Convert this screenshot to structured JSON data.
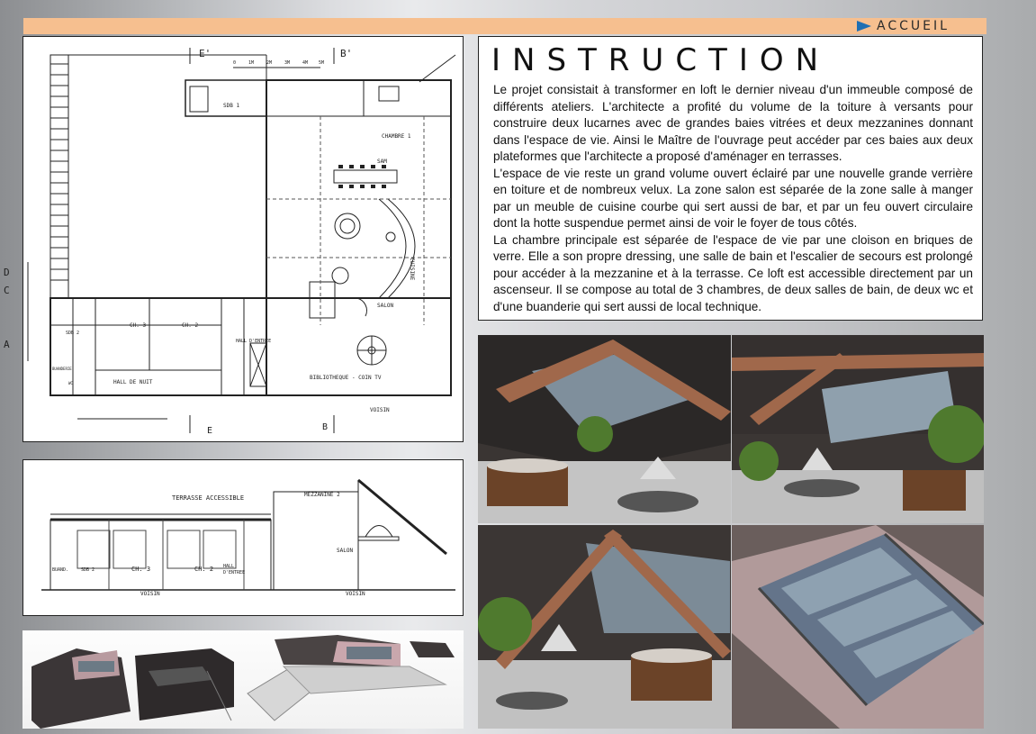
{
  "header": {
    "nav_label": "ACCUEIL",
    "accent_color": "#f6bf8f",
    "arrow_color": "#1f6fb3"
  },
  "plan": {
    "markers": {
      "e_top": "E'",
      "b_top": "B'",
      "e_bottom": "E",
      "b_bottom": "B",
      "d": "D",
      "c": "C",
      "a": "A"
    },
    "scale_labels": [
      "0",
      "1M",
      "2M",
      "3M",
      "4M",
      "5M"
    ],
    "rooms": {
      "sdb1": "SDB 1",
      "chambre1": "CHAMBRE 1",
      "sam": "SAM",
      "cuisine": "CUISINE",
      "salon": "SALON",
      "ch3": "CH. 3",
      "ch2": "CH. 2",
      "sdb2": "SDB 2",
      "buanderie": "BUANDERIE",
      "wc": "WC",
      "hall_nuit": "HALL DE NUIT",
      "hall_entree": "HALL D'ENTREE",
      "bibliotheque": "BIBLIOTHEQUE - COIN TV",
      "voisin": "VOISIN"
    }
  },
  "section": {
    "labels": {
      "terrasse": "TERRASSE ACCESSIBLE",
      "mezzanine": "MEZZANINE 2",
      "salon": "SALON",
      "buand": "BUAND.",
      "sdb2": "SDB 2",
      "ch3": "CH. 3",
      "ch2": "CH. 2",
      "hall": "HALL",
      "hall2": "D'ENTREE",
      "voisin_left": "VOISIN",
      "voisin_right": "VOISIN"
    }
  },
  "instruction": {
    "title": "INSTRUCTION",
    "paragraphs": [
      "Le projet consistait à transformer en loft le dernier niveau d'un immeuble composé de différents ateliers. L'architecte a profité du volume de la toiture à versants pour construire deux lucarnes avec de grandes baies vitrées et deux mezzanines donnant dans l'espace de vie. Ainsi le Maître de l'ouvrage peut accéder par ces baies aux deux plateformes que l'architecte a proposé d'aménager en terrasses.",
      "L'espace de vie reste un grand volume ouvert éclairé par une nouvelle grande verrière en toiture et de nombreux velux. La zone salon est séparée de la zone salle à manger par un meuble de cuisine courbe qui sert aussi de bar, et par un feu ouvert circulaire dont la hotte suspendue permet ainsi de voir le foyer de tous côtés.",
      "La chambre principale est séparée de l'espace de vie par une cloison en briques de verre. Elle a son propre dressing, une salle de bain et l'escalier de secours est prolongé pour accéder à la mezzanine et à la terrasse. Ce loft est accessible directement par un ascenseur. Il se compose au total de 3 chambres, de deux salles de bain, de deux wc et d'une buanderie qui sert aussi de local technique."
    ]
  }
}
